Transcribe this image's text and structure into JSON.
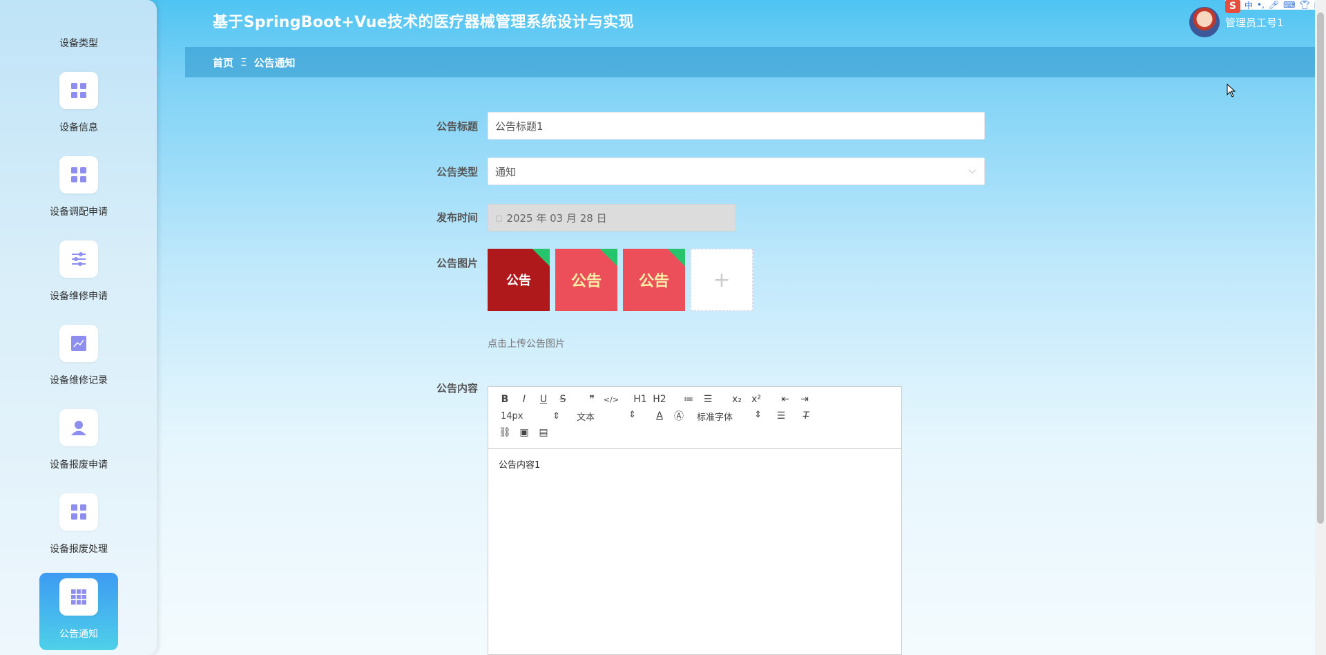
{
  "header": {
    "title": "基于SpringBoot+Vue技术的医疗器械管理系统设计与实现"
  },
  "user": {
    "name": "管理员工号1"
  },
  "tray": {
    "lang": "中"
  },
  "breadcrumb": {
    "home": "首页",
    "separator": "Ξ",
    "current": "公告通知"
  },
  "sidebar": {
    "items": [
      {
        "label": "设备类型",
        "icon": "grid-icon"
      },
      {
        "label": "设备信息",
        "icon": "grid-icon"
      },
      {
        "label": "设备调配申请",
        "icon": "grid-icon"
      },
      {
        "label": "设备维修申请",
        "icon": "sliders-icon"
      },
      {
        "label": "设备维修记录",
        "icon": "chart-icon"
      },
      {
        "label": "设备报废申请",
        "icon": "user-icon"
      },
      {
        "label": "设备报废处理",
        "icon": "grid-icon"
      },
      {
        "label": "公告通知",
        "icon": "table-icon",
        "active": true
      }
    ]
  },
  "form": {
    "title_label": "公告标题",
    "title_value": "公告标题1",
    "type_label": "公告类型",
    "type_value": "通知",
    "time_label": "发布时间",
    "time_value": "2025 年 03 月 28 日",
    "image_label": "公告图片",
    "images": [
      {
        "text": "公告"
      },
      {
        "text": "公告"
      },
      {
        "text": "公告"
      }
    ],
    "upload_hint": "点击上传公告图片",
    "content_label": "公告内容",
    "content_value": "公告内容1"
  },
  "editor": {
    "row1": [
      "B",
      "I",
      "U",
      "S",
      "❞",
      "</>",
      "H1",
      "H2",
      "≔",
      "☰",
      "x₂",
      "x²",
      "⇤",
      "⇥"
    ],
    "font_size": "14px",
    "paragraph": "文本",
    "font_family": "标准字体"
  },
  "colors": {
    "accent": "#3d9bf2",
    "header_bg": "#4fc4f2",
    "icon": "#8e8ef0"
  }
}
